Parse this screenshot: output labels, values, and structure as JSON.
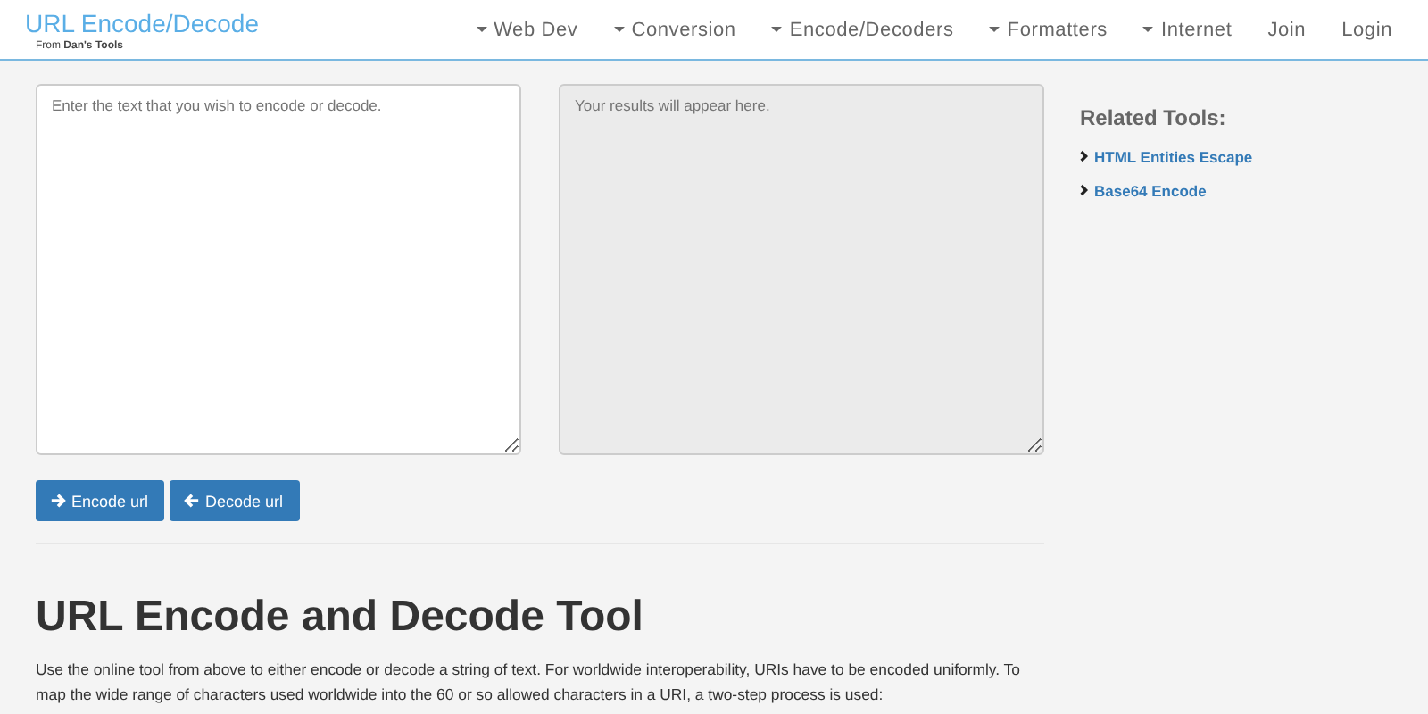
{
  "brand": {
    "title": "URL Encode/Decode",
    "subtitle": "From **Dan's Tools**"
  },
  "nav": [
    {
      "label": "Web Dev",
      "kind": "dropdown"
    },
    {
      "label": "Conversion",
      "kind": "dropdown"
    },
    {
      "label": "Encode/Decoders",
      "kind": "dropdown"
    },
    {
      "label": "Formatters",
      "kind": "dropdown"
    },
    {
      "label": "Internet",
      "kind": "dropdown"
    },
    {
      "label": "Join",
      "kind": "link"
    },
    {
      "label": "Login",
      "kind": "link"
    }
  ],
  "input": {
    "placeholder": "Enter the text that you wish to encode or decode."
  },
  "output": {
    "placeholder": "Your results will appear here.",
    "disabled": true
  },
  "buttons": [
    {
      "label": "Encode url",
      "kind": "right"
    },
    {
      "label": "Decode url",
      "kind": "left"
    }
  ],
  "heading": "URL Encode and Decode Tool",
  "paragraph": "Use the online tool from above to either encode or decode a string of text. For worldwide interoperability, URIs have to be encoded uniformly. To map the wide range of characters used worldwide into the 60 or so allowed characters in a URI, a two-step process is used:",
  "related": {
    "title": "Related Tools:",
    "items": [
      "HTML Entities Escape",
      "Base64 Encode"
    ]
  }
}
